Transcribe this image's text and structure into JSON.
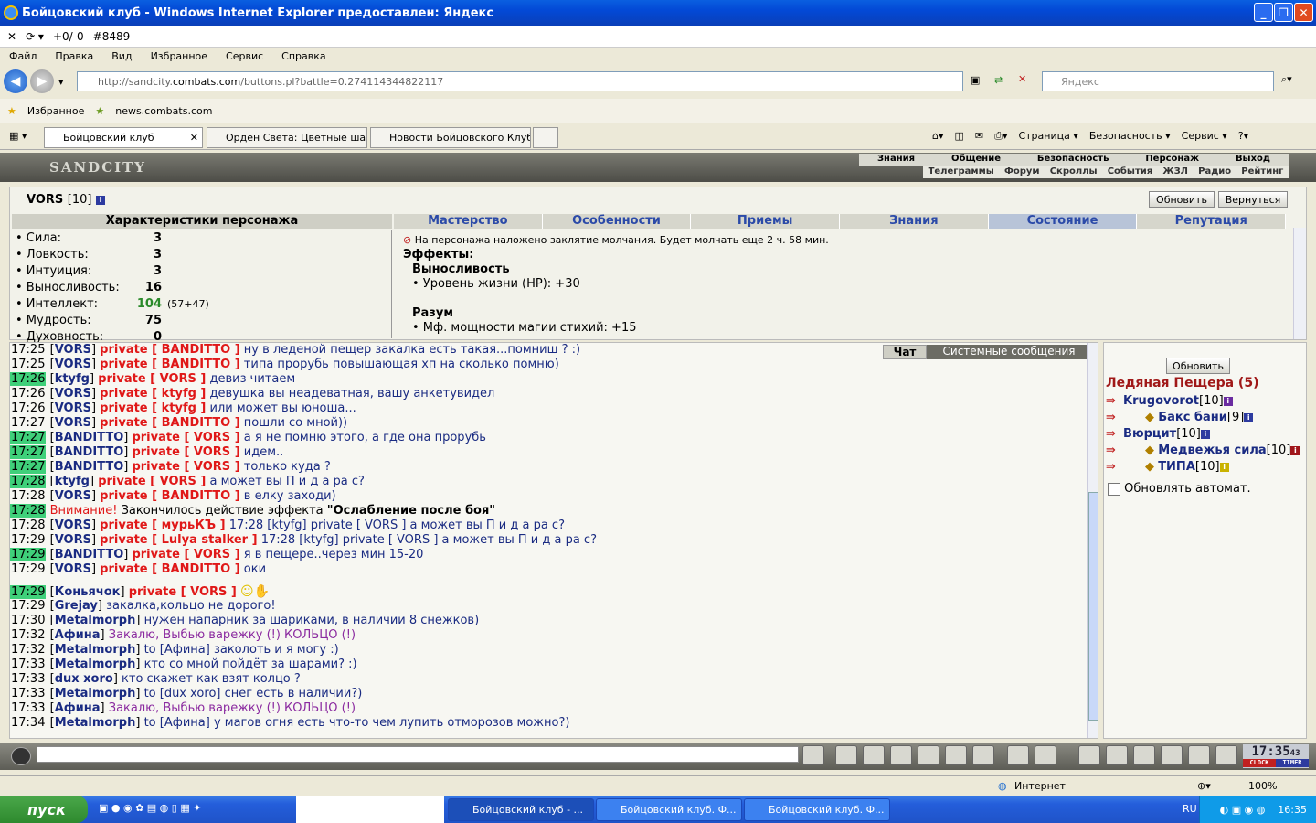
{
  "window": {
    "title": "Бойцовский клуб - Windows Internet Explorer предоставлен: Яндекс"
  },
  "toolbar2": {
    "counter": "+0/-0",
    "id": "#8489"
  },
  "menu": [
    "Файл",
    "Правка",
    "Вид",
    "Избранное",
    "Сервис",
    "Справка"
  ],
  "address": {
    "prefix": "http://sandcity.",
    "domain": "combats.com",
    "path": "/buttons.pl?battle=0.274114344822117",
    "search_placeholder": "Яндекс"
  },
  "favorites": {
    "label": "Избранное",
    "link": "news.combats.com"
  },
  "tabs": [
    "Бойцовский клуб",
    "Орден Света: Цветные ша...",
    "Новости Бойцовского Клуб..."
  ],
  "ie_tools": [
    "Страница",
    "Безопасность",
    "Сервис"
  ],
  "game": {
    "logo": "SANDCITY",
    "top_menu": [
      "Знания",
      "Общение",
      "Безопасность",
      "Персонаж",
      "Выход"
    ],
    "sub_menu": [
      "Телеграммы",
      "Форум",
      "Скроллы",
      "События",
      "ЖЗЛ",
      "Радио",
      "Рейтинг"
    ]
  },
  "character": {
    "name": "VORS",
    "level": "[10]",
    "refresh": "Обновить",
    "back": "Вернуться",
    "stats_title": "Характеристики персонажа",
    "stats": [
      {
        "label": "• Сила:",
        "value": "3",
        "extra": ""
      },
      {
        "label": "• Ловкость:",
        "value": "3",
        "extra": ""
      },
      {
        "label": "• Интуиция:",
        "value": "3",
        "extra": ""
      },
      {
        "label": "• Выносливость:",
        "value": "16",
        "extra": ""
      },
      {
        "label": "• Интеллект:",
        "value": "104",
        "extra": "(57+47)"
      },
      {
        "label": "• Мудрость:",
        "value": "75",
        "extra": ""
      },
      {
        "label": "• Духовность:",
        "value": "0",
        "extra": ""
      }
    ],
    "panel_tabs": [
      "Мастерство",
      "Особенности",
      "Приемы",
      "Знания",
      "Состояние",
      "Репутация"
    ],
    "silence": "На персонажа наложено заклятие молчания. Будет молчать еще 2 ч. 58 мин.",
    "effects_title": "Эффекты:",
    "effects": [
      {
        "group": "Выносливость",
        "line": "• Уровень жизни (HP): +30"
      },
      {
        "group": "Разум",
        "line": "• Мф. мощности магии стихий: +15"
      }
    ]
  },
  "chat": {
    "tab_chat": "Чат",
    "tab_system": "Системные сообщения",
    "lines": [
      {
        "time": "17:25",
        "hl": false,
        "nick": "VORS",
        "priv": "private [ BANDITTO ]",
        "text": "ну в леденой пещер закалка есть такая...помниш ? :)",
        "style": "msg"
      },
      {
        "time": "17:25",
        "hl": false,
        "nick": "VORS",
        "priv": "private [ BANDITTO ]",
        "text": "типа прорубь повышающая хп на сколько помню)",
        "style": "msg"
      },
      {
        "time": "17:26",
        "hl": true,
        "nick": "ktyfg",
        "priv": "private [ VORS ]",
        "text": "девиз читаем",
        "style": "msg"
      },
      {
        "time": "17:26",
        "hl": false,
        "nick": "VORS",
        "priv": "private [ ktyfg ]",
        "text": "девушка вы неадеватная, вашу анкетувидел",
        "style": "msg"
      },
      {
        "time": "17:26",
        "hl": false,
        "nick": "VORS",
        "priv": "private [ ktyfg ]",
        "text": "или может вы юноша...",
        "style": "msg"
      },
      {
        "time": "17:27",
        "hl": false,
        "nick": "VORS",
        "priv": "private [ BANDITTO ]",
        "text": "пошли со мной))",
        "style": "msg"
      },
      {
        "time": "17:27",
        "hl": true,
        "nick": "BANDITTO",
        "priv": "private [ VORS ]",
        "text": "а я не помню этого, а где она прорубь",
        "style": "msg"
      },
      {
        "time": "17:27",
        "hl": true,
        "nick": "BANDITTO",
        "priv": "private [ VORS ]",
        "text": "идем..",
        "style": "msg"
      },
      {
        "time": "17:27",
        "hl": true,
        "nick": "BANDITTO",
        "priv": "private [ VORS ]",
        "text": "только куда ?",
        "style": "msg"
      },
      {
        "time": "17:28",
        "hl": true,
        "nick": "ktyfg",
        "priv": "private [ VORS ]",
        "text": "а может вы П и д а ра с?",
        "style": "msg"
      },
      {
        "time": "17:28",
        "hl": false,
        "nick": "VORS",
        "priv": "private [ BANDITTO ]",
        "text": "в елку заходи)",
        "style": "msg"
      },
      {
        "time": "17:28",
        "hl": true,
        "sys": true,
        "warn": "Внимание!",
        "text": "Закончилось действие эффекта ",
        "bold": "\"Ослабление после боя\""
      },
      {
        "time": "17:28",
        "hl": false,
        "nick": "VORS",
        "priv": "private [ мурьКЪ ]",
        "text": "17:28 [ktyfg] private [ VORS ] а может вы П и д а ра с?",
        "style": "msg"
      },
      {
        "time": "17:29",
        "hl": false,
        "nick": "VORS",
        "priv": "private [ Lulya stalker ]",
        "text": "17:28 [ktyfg] private [ VORS ] а может вы П и д а ра с?",
        "style": "msg"
      },
      {
        "time": "17:29",
        "hl": true,
        "nick": "BANDITTO",
        "priv": "private [ VORS ]",
        "text": "я в пещере..через мин 15-20",
        "style": "msg"
      },
      {
        "time": "17:29",
        "hl": false,
        "nick": "VORS",
        "priv": "private [ BANDITTO ]",
        "text": "оки",
        "style": "msg"
      },
      {
        "time": "17:29",
        "hl": true,
        "nick": "Коньячок",
        "priv": "private [ VORS ]",
        "text": "",
        "style": "msg",
        "smile": true
      },
      {
        "time": "17:29",
        "hl": false,
        "nick": "Grejay",
        "priv": "",
        "text": "закалка,кольцо не дорого!",
        "style": "msg"
      },
      {
        "time": "17:30",
        "hl": false,
        "nick": "Metalmorph",
        "priv": "",
        "text": "нужен напарник за шариками, в наличии 8 снежков)",
        "style": "msg"
      },
      {
        "time": "17:32",
        "hl": false,
        "nick": "Афина",
        "priv": "",
        "text": "Закалю, Выбью варежку (!) КОЛЬЦО (!)",
        "style": "ms"
      },
      {
        "time": "17:32",
        "hl": false,
        "nick": "Metalmorph",
        "priv": "",
        "text": "to [Афина] заколоть и я могу :)",
        "style": "msg"
      },
      {
        "time": "17:33",
        "hl": false,
        "nick": "Metalmorph",
        "priv": "",
        "text": "кто со мной пойдёт за шарами? :)",
        "style": "msg"
      },
      {
        "time": "17:33",
        "hl": false,
        "nick": "dux xoro",
        "priv": "",
        "text": "кто скажет как взят колцо ?",
        "style": "msg"
      },
      {
        "time": "17:33",
        "hl": false,
        "nick": "Metalmorph",
        "priv": "",
        "text": "to [dux xoro] снег есть в наличии?)",
        "style": "msg"
      },
      {
        "time": "17:33",
        "hl": false,
        "nick": "Афина",
        "priv": "",
        "text": "Закалю, Выбью варежку (!) КОЛЬЦО (!)",
        "style": "ms"
      },
      {
        "time": "17:34",
        "hl": false,
        "nick": "Metalmorph",
        "priv": "",
        "text": "to [Афина] у магов огня есть что-то чем лупить отморозов можно?)",
        "style": "msg"
      }
    ]
  },
  "users": {
    "refresh": "Обновить",
    "location": "Ледяная Пещера (5)",
    "list": [
      {
        "name": "Krugovorot",
        "level": "[10]",
        "badge": "p",
        "indent": false
      },
      {
        "name": "Бакс бани",
        "level": "[9]",
        "badge": "",
        "indent": true
      },
      {
        "name": "Вюрцит",
        "level": "[10]",
        "badge": "",
        "indent": false
      },
      {
        "name": "Медвежья сила",
        "level": "[10]",
        "badge": "r",
        "indent": true
      },
      {
        "name": "ТИПА",
        "level": "[10]",
        "badge": "y",
        "indent": true
      }
    ],
    "auto": "Обновлять автомат."
  },
  "clock": {
    "time": "17:35",
    "sec": "43",
    "label1": "CLOCK",
    "label2": "TIMER"
  },
  "statusbar": {
    "zone": "Интернет",
    "zoom": "100%"
  },
  "taskbar": {
    "start": "пуск",
    "items": [
      "Бойцовский клуб - ...",
      "Бойцовский клуб. Ф...",
      "Бойцовский клуб. Ф..."
    ],
    "lang": "RU",
    "time": "16:35"
  }
}
